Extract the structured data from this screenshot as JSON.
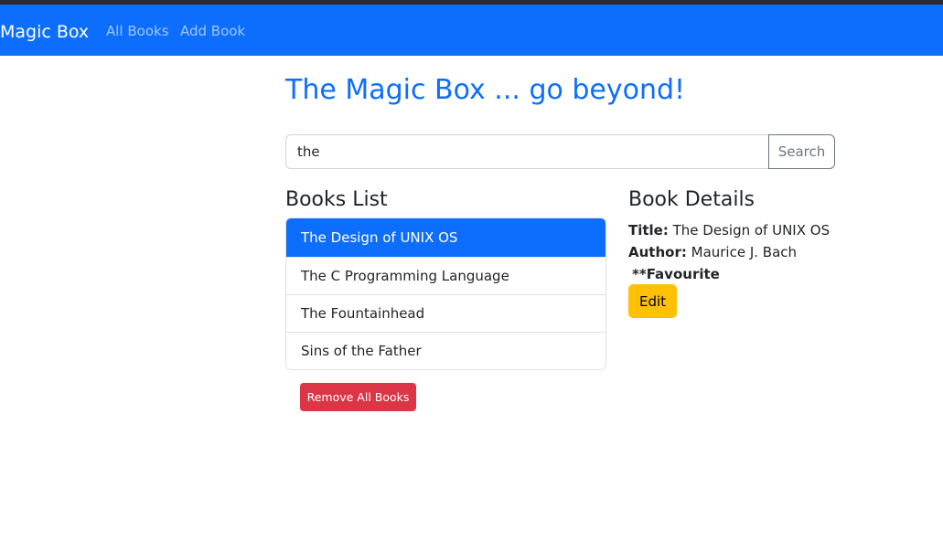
{
  "navbar": {
    "brand": "Magic Box",
    "links": [
      "All Books",
      "Add Book"
    ],
    "bg_color": "#0d6efd"
  },
  "main": {
    "headline": "The Magic Box ... go beyond!",
    "search": {
      "value": "the",
      "button_label": "Search"
    },
    "books_list": {
      "title": "Books List",
      "items": [
        {
          "label": "The Design of UNIX OS",
          "active": true
        },
        {
          "label": "The C Programming Language",
          "active": false
        },
        {
          "label": "The Fountainhead",
          "active": false
        },
        {
          "label": "Sins of the Father",
          "active": false
        }
      ],
      "remove_all_label": "Remove All Books"
    },
    "details": {
      "title": "Book Details",
      "title_label": "Title:",
      "title_value": "The Design of UNIX OS",
      "author_label": "Author:",
      "author_value": "Maurice J. Bach",
      "favourite": "**Favourite",
      "edit_label": "Edit"
    }
  },
  "colors": {
    "primary": "#0d6efd",
    "danger": "#dc3545",
    "warning": "#ffc107"
  }
}
